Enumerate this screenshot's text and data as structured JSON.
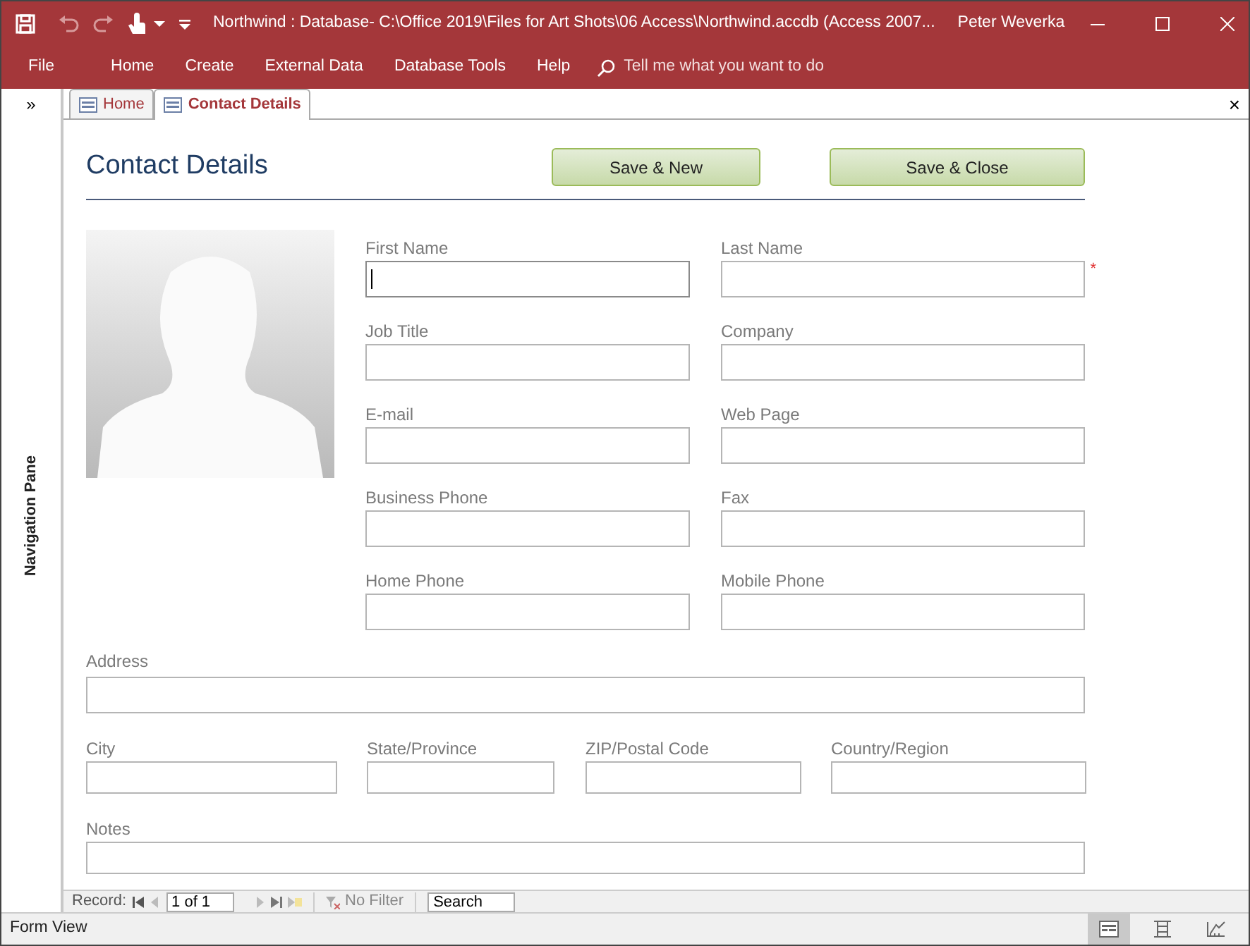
{
  "window": {
    "title": "Northwind : Database- C:\\Office 2019\\Files for Art Shots\\06 Access\\Northwind.accdb (Access 2007...",
    "user": "Peter Weverka"
  },
  "ribbon_tabs": [
    "File",
    "Home",
    "Create",
    "External Data",
    "Database Tools",
    "Help"
  ],
  "tell_me": {
    "placeholder": "Tell me what you want to do"
  },
  "navigation_pane": {
    "toggle": "»",
    "label": "Navigation Pane"
  },
  "document_tabs": [
    {
      "label": "Home",
      "selected": false
    },
    {
      "label": "Contact Details",
      "selected": true
    }
  ],
  "close_document": "×",
  "form": {
    "title": "Contact Details",
    "buttons": [
      "Save & New",
      "Save & Close"
    ],
    "fields": [
      {
        "label": "First Name",
        "focused": true
      },
      {
        "label": "Last Name",
        "focused": false,
        "required_mark": "*"
      },
      {
        "label": "Job Title",
        "focused": false
      },
      {
        "label": "Company",
        "focused": false
      },
      {
        "label": "E-mail",
        "focused": false
      },
      {
        "label": "Web Page",
        "focused": false
      },
      {
        "label": "Business Phone",
        "focused": false
      },
      {
        "label": "Fax",
        "focused": false
      },
      {
        "label": "Home Phone",
        "focused": false
      },
      {
        "label": "Mobile Phone",
        "focused": false
      }
    ],
    "address": {
      "label": "Address"
    },
    "location_fields": [
      {
        "label": "City"
      },
      {
        "label": "State/Province"
      },
      {
        "label": "ZIP/Postal Code"
      },
      {
        "label": "Country/Region"
      }
    ],
    "notes": {
      "label": "Notes"
    }
  },
  "record_navigator": {
    "label": "Record:",
    "position": "1 of 1",
    "filter": "No Filter",
    "search": "Search"
  },
  "status_bar": {
    "text": "Form View",
    "views": [
      {
        "selected": true
      },
      {
        "selected": false
      },
      {
        "selected": false
      }
    ]
  }
}
